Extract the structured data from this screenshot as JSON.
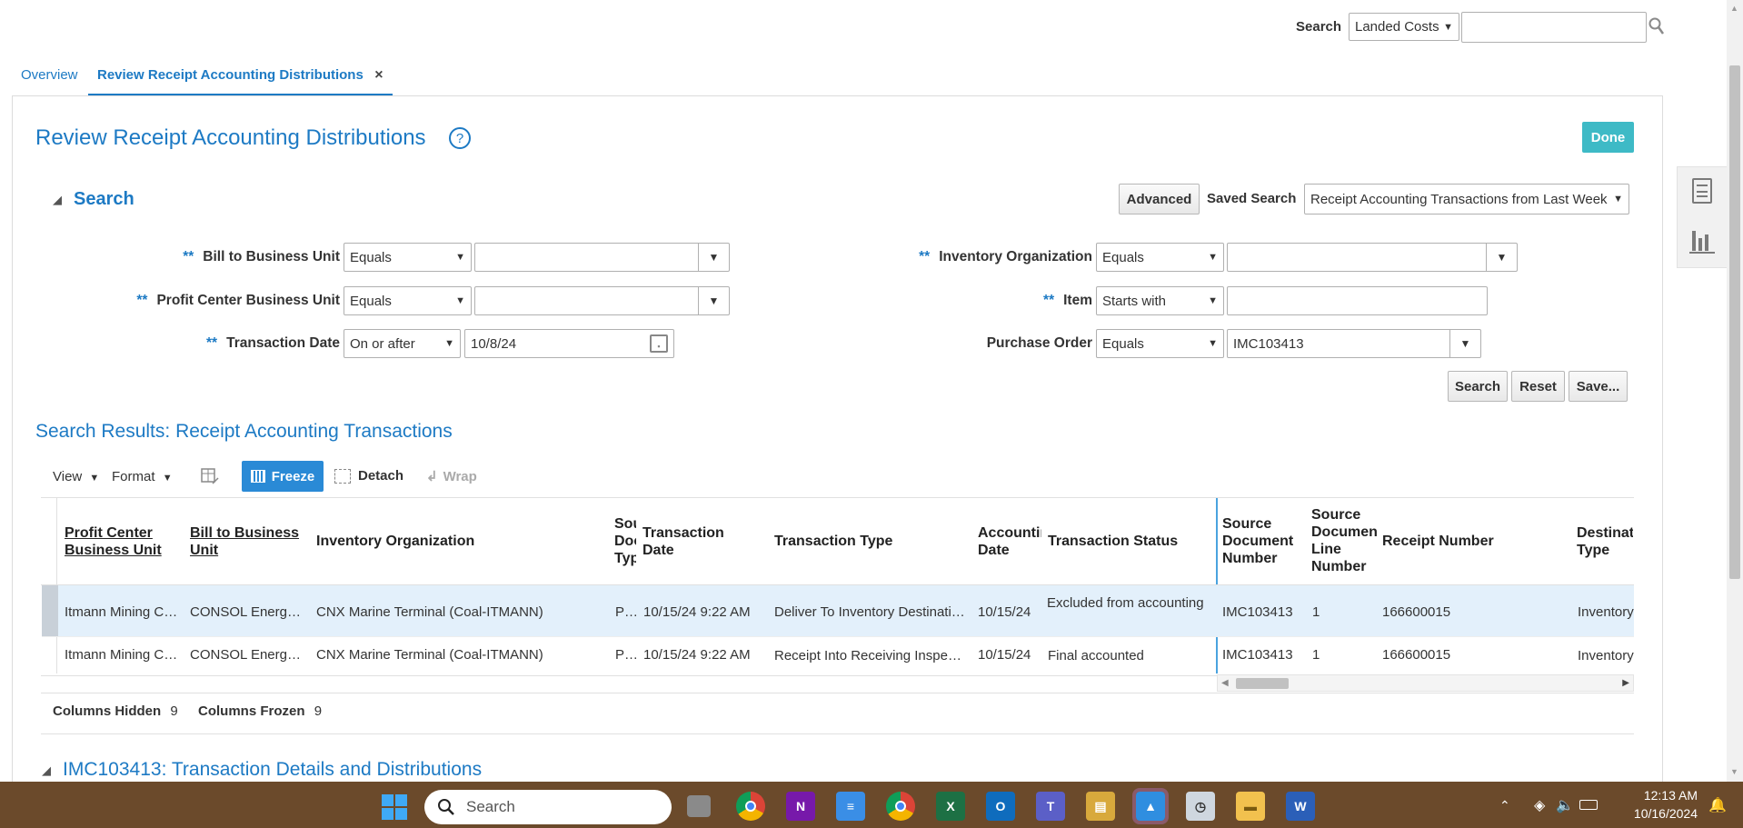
{
  "top_search": {
    "label": "Search",
    "category": "Landed Costs",
    "value": ""
  },
  "tabs": [
    {
      "label": "Overview"
    },
    {
      "label": "Review Receipt Accounting Distributions",
      "close": "×"
    }
  ],
  "page": {
    "title": "Review Receipt Accounting Distributions",
    "done_label": "Done"
  },
  "search_panel": {
    "title": "Search",
    "advanced_label": "Advanced",
    "saved_search_label": "Saved Search",
    "saved_search_value": "Receipt Accounting Transactions from Last Week",
    "required_mark": "**",
    "fields": {
      "bill_to": {
        "label": "Bill to Business Unit",
        "op": "Equals",
        "value": ""
      },
      "profit_center": {
        "label": "Profit Center Business Unit",
        "op": "Equals",
        "value": ""
      },
      "txn_date": {
        "label": "Transaction Date",
        "op": "On or after",
        "value": "10/8/24"
      },
      "inv_org": {
        "label": "Inventory Organization",
        "op": "Equals",
        "value": ""
      },
      "item": {
        "label": "Item",
        "op": "Starts with",
        "value": ""
      },
      "po": {
        "label": "Purchase Order",
        "op": "Equals",
        "value": "IMC103413"
      }
    },
    "buttons": {
      "search": "Search",
      "reset": "Reset",
      "save": "Save..."
    }
  },
  "results": {
    "title": "Search Results: Receipt Accounting Transactions",
    "toolbar": {
      "view": "View",
      "format": "Format",
      "freeze": "Freeze",
      "detach": "Detach",
      "wrap": "Wrap"
    },
    "headers": {
      "profit_center": "Profit Center Business Unit",
      "bill_to": "Bill to Business Unit",
      "inv_org": "Inventory Organization",
      "src_doc_type": "Source Document Type",
      "txn_date": "Transaction Date",
      "txn_type": "Transaction Type",
      "acct_date": "Accounting Date",
      "txn_status": "Transaction Status",
      "src_doc_num": "Source Document Number",
      "src_doc_line": "Source Document Line Number",
      "receipt_num": "Receipt Number",
      "dest_type": "Destination Type"
    },
    "rows": [
      {
        "profit_center": "Itmann Mining C…",
        "bill_to": "CONSOL Energ…",
        "inv_org": "CNX Marine Terminal (Coal-ITMANN)",
        "src_doc_type": "P…",
        "txn_date": "10/15/24 9:22 AM",
        "txn_type": "Deliver To Inventory Destinati…",
        "acct_date": "10/15/24",
        "txn_status": "Excluded from accounting",
        "src_doc_num": "IMC103413",
        "src_doc_line": "1",
        "receipt_num": "166600015",
        "dest_type": "Inventory"
      },
      {
        "profit_center": "Itmann Mining C…",
        "bill_to": "CONSOL Energ…",
        "inv_org": "CNX Marine Terminal (Coal-ITMANN)",
        "src_doc_type": "P…",
        "txn_date": "10/15/24 9:22 AM",
        "txn_type": "Receipt Into Receiving Inspe…",
        "acct_date": "10/15/24",
        "txn_status": "Final accounted",
        "src_doc_num": "IMC103413",
        "src_doc_line": "1",
        "receipt_num": "166600015",
        "dest_type": "Inventory"
      }
    ],
    "footer": {
      "hidden_label": "Columns Hidden",
      "hidden_count": "9",
      "frozen_label": "Columns Frozen",
      "frozen_count": "9"
    }
  },
  "details": {
    "title": "IMC103413: Transaction Details and Distributions"
  },
  "taskbar": {
    "search_placeholder": "Search",
    "time": "12:13 AM",
    "date": "10/16/2024"
  },
  "colors": {
    "accent": "#1d7ac4",
    "done": "#3ebac6",
    "selected_row": "#e3f0fb",
    "taskbar": "#6b4a2b"
  }
}
